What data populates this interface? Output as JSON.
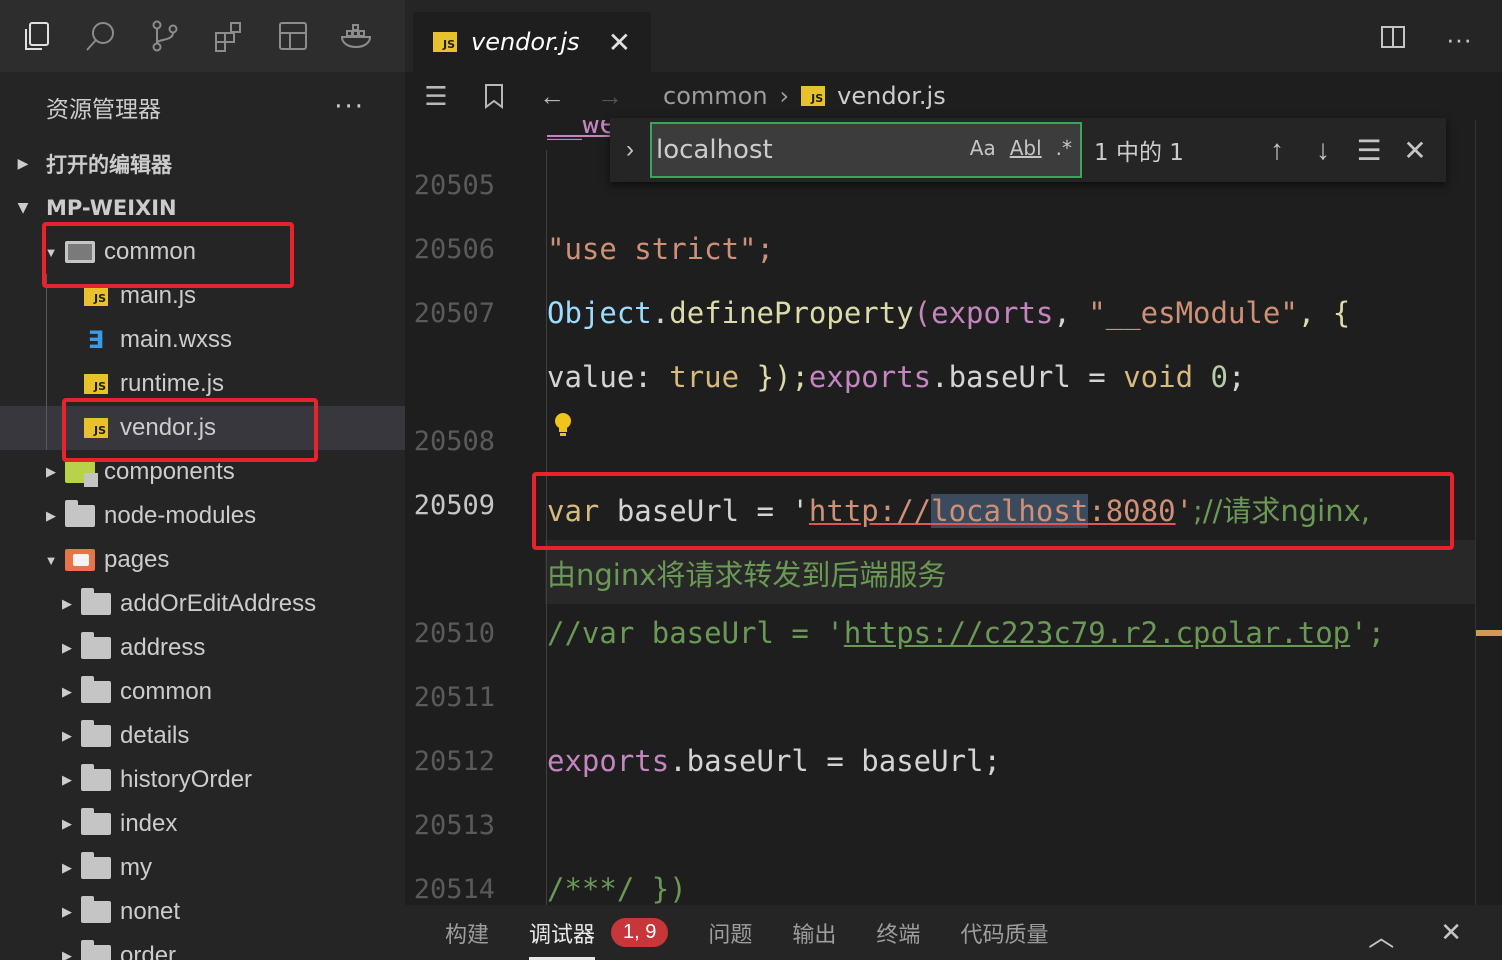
{
  "activity_bar": {
    "icons": [
      "explorer-icon",
      "search-icon",
      "source-control-icon",
      "extensions-icon",
      "layout-icon",
      "docker-icon"
    ]
  },
  "sidebar": {
    "title": "资源管理器",
    "more": "···",
    "open_editors_label": "打开的编辑器",
    "project_label": "MP-WEIXIN",
    "tree": [
      {
        "label": "common",
        "type": "folder-open",
        "depth": 1,
        "expanded": true
      },
      {
        "label": "main.js",
        "type": "js",
        "depth": 2
      },
      {
        "label": "main.wxss",
        "type": "css",
        "depth": 2
      },
      {
        "label": "runtime.js",
        "type": "js",
        "depth": 2
      },
      {
        "label": "vendor.js",
        "type": "js",
        "depth": 2,
        "selected": true
      },
      {
        "label": "components",
        "type": "folder-comp",
        "depth": 1,
        "expanded": false
      },
      {
        "label": "node-modules",
        "type": "folder",
        "depth": 1,
        "expanded": false
      },
      {
        "label": "pages",
        "type": "folder-pages",
        "depth": 1,
        "expanded": true
      },
      {
        "label": "addOrEditAddress",
        "type": "folder",
        "depth": 2,
        "expanded": false
      },
      {
        "label": "address",
        "type": "folder",
        "depth": 2,
        "expanded": false
      },
      {
        "label": "common",
        "type": "folder",
        "depth": 2,
        "expanded": false
      },
      {
        "label": "details",
        "type": "folder",
        "depth": 2,
        "expanded": false
      },
      {
        "label": "historyOrder",
        "type": "folder",
        "depth": 2,
        "expanded": false
      },
      {
        "label": "index",
        "type": "folder",
        "depth": 2,
        "expanded": false
      },
      {
        "label": "my",
        "type": "folder",
        "depth": 2,
        "expanded": false
      },
      {
        "label": "nonet",
        "type": "folder",
        "depth": 2,
        "expanded": false
      },
      {
        "label": "order",
        "type": "folder",
        "depth": 2,
        "expanded": false
      }
    ]
  },
  "editor_tab": {
    "label": "vendor.js",
    "close": "✕"
  },
  "tab_actions": {
    "split": "split-editor-icon",
    "more": "···"
  },
  "breadcrumb": {
    "folder": "common",
    "sep": "›",
    "file": "vendor.js"
  },
  "find": {
    "value": "localhost",
    "match_case": "Aa",
    "whole_word": "Abl",
    "regex": ".*",
    "count": "1 中的 1"
  },
  "code": {
    "top_fragment": "__we",
    "lines": [
      {
        "no": "20505"
      },
      {
        "no": "20506",
        "text": "\"use strict\";"
      },
      {
        "no": "20507",
        "a": "Object",
        "b": ".",
        "c": "defineProperty",
        "d": "(",
        "e": "exports",
        "f": ", ",
        "g": "\"__esModule\"",
        "h": ", {"
      },
      {
        "cont": true,
        "a": "value",
        "b": ": ",
        "c": "true",
        "d": " });",
        "e": "exports",
        "f": ".baseUrl = ",
        "g": "void",
        "h": " ",
        "i": "0",
        "j": ";"
      },
      {
        "no": "20508"
      },
      {
        "no": "20509",
        "a": "var",
        "b": " baseUrl = '",
        "c": "http://",
        "d": "localhost",
        "e": ":8080",
        "f": "'",
        "g": ";//请求nginx,"
      },
      {
        "cont": true,
        "text": "由nginx将请求转发到后端服务"
      },
      {
        "no": "20510",
        "a": "//var baseUrl = '",
        "b": "https://c223c79.r2.cpolar.top",
        "c": "';"
      },
      {
        "no": "20511"
      },
      {
        "no": "20512",
        "a": "exports",
        "b": ".baseUrl = baseUrl;"
      },
      {
        "no": "20513"
      },
      {
        "no": "20514",
        "text": "/***/ })"
      }
    ]
  },
  "panel": {
    "tabs": [
      "构建",
      "调试器",
      "问题",
      "输出",
      "终端",
      "代码质量"
    ],
    "badge": "1, 9",
    "active": "调试器"
  },
  "colors": {
    "highlight_box": "#e8222e",
    "find_border": "#3ba55c",
    "js_icon": "#e8c22c",
    "badge": "#c73638"
  }
}
